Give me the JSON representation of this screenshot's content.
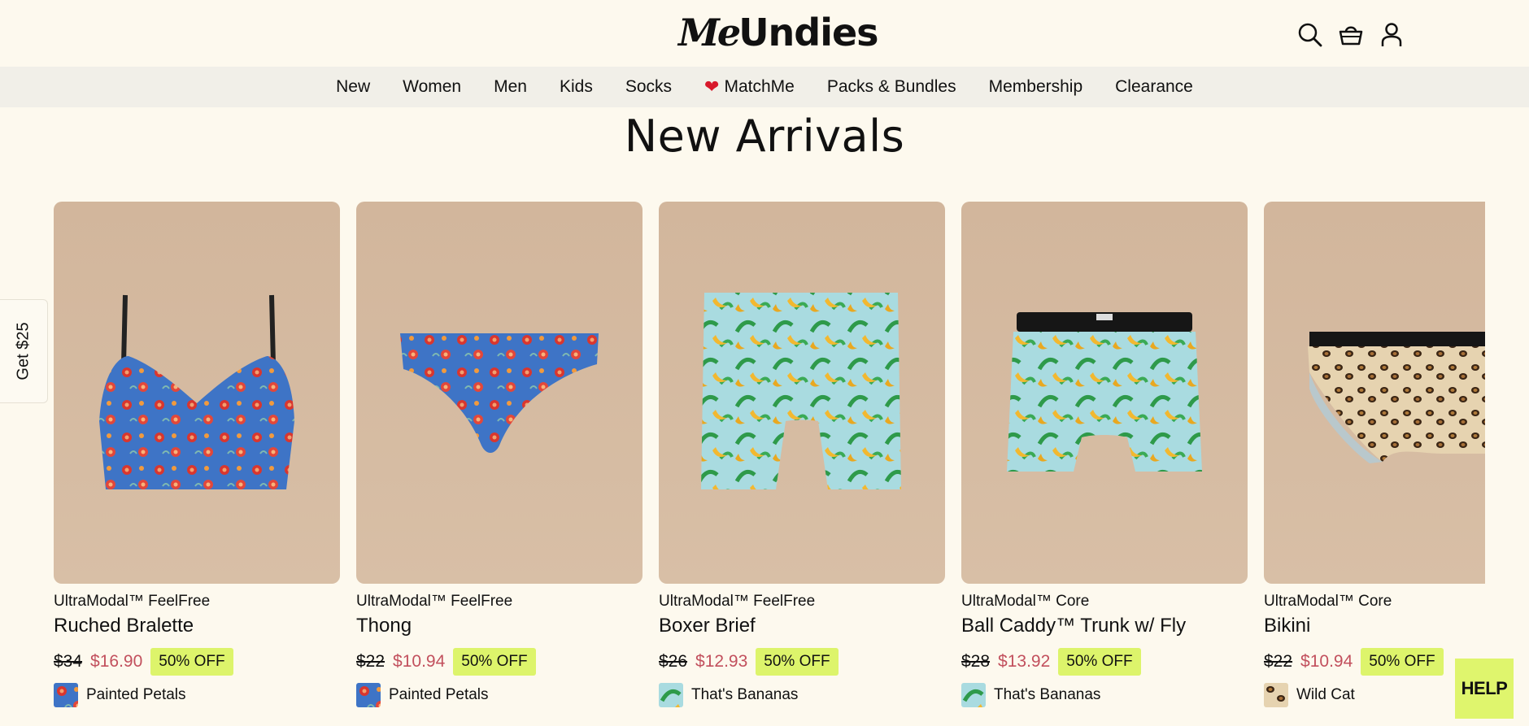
{
  "brand": {
    "logo_me": "Me",
    "logo_undies": "Undies"
  },
  "header_icons": [
    "search-icon",
    "cart-icon",
    "account-icon"
  ],
  "nav": {
    "items": [
      {
        "label": "New"
      },
      {
        "label": "Women"
      },
      {
        "label": "Men"
      },
      {
        "label": "Kids"
      },
      {
        "label": "Socks"
      },
      {
        "label": "MatchMe",
        "icon": "heart-icon"
      },
      {
        "label": "Packs & Bundles"
      },
      {
        "label": "Membership"
      },
      {
        "label": "Clearance"
      }
    ]
  },
  "section": {
    "title": "New Arrivals"
  },
  "products": [
    {
      "collection": "UltraModal™ FeelFree",
      "name": "Ruched Bralette",
      "old_price": "$34",
      "price": "$16.90",
      "badge": "50% OFF",
      "print": "Painted Petals"
    },
    {
      "collection": "UltraModal™ FeelFree",
      "name": "Thong",
      "old_price": "$22",
      "price": "$10.94",
      "badge": "50% OFF",
      "print": "Painted Petals"
    },
    {
      "collection": "UltraModal™ FeelFree",
      "name": "Boxer Brief",
      "old_price": "$26",
      "price": "$12.93",
      "badge": "50% OFF",
      "print": "That's Bananas"
    },
    {
      "collection": "UltraModal™ Core",
      "name": "Ball Caddy™ Trunk w/ Fly",
      "old_price": "$28",
      "price": "$13.92",
      "badge": "50% OFF",
      "print": "That's Bananas"
    },
    {
      "collection": "UltraModal™ Core",
      "name": "Bikini",
      "old_price": "$22",
      "price": "$10.94",
      "badge": "50% OFF",
      "print": "Wild Cat"
    }
  ],
  "side_tab": {
    "label": "Get $25"
  },
  "help": {
    "label": "HELP"
  },
  "colors": {
    "background": "#fdf9ee",
    "nav_bg": "#f1efe8",
    "sale_price": "#c2505d",
    "badge": "#ddf46b",
    "image_bg": "#d6bca3",
    "heart": "#d8192b"
  }
}
